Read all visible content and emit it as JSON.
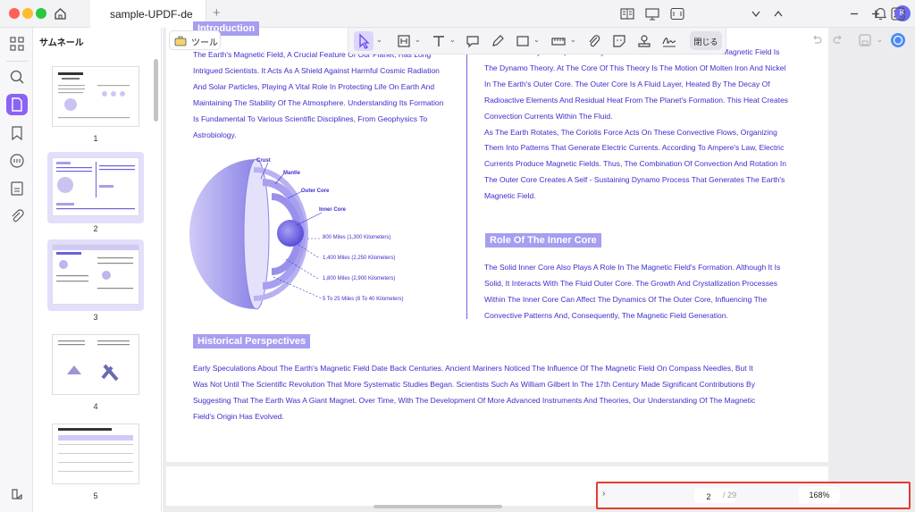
{
  "window": {
    "tab_title": "sample-UPDF-de",
    "add_tab": "+",
    "avatar_letter": "K"
  },
  "sidebar": {
    "title": "サムネール",
    "pages": [
      "1",
      "2",
      "3",
      "4",
      "5"
    ],
    "selected_pages": [
      "2",
      "3"
    ]
  },
  "toolbar": {
    "tools_label": "ツール",
    "close_label": "閉じる",
    "accent_color": "#8a63f5"
  },
  "document": {
    "intro_heading": "Introduction",
    "intro_lines": [
      "The Earth's Magnetic Field, A Crucial Feature Of Our Planet, Has Long",
      "Intrigued Scientists. It Acts As A Shield Against Harmful Cosmic Radiation",
      "And Solar Particles, Playing A Vital Role In Protecting Life On Earth And",
      "Maintaining The Stability Of The Atmosphere. Understanding Its Formation",
      "Is Fundamental To Various Scientific Disciplines, From Geophysics To",
      "Astrobiology."
    ],
    "diagram_labels": [
      "Crust",
      "Mantle",
      "Outer Core",
      "Inner Core"
    ],
    "diagram_dims": [
      "800 Miles (1,300 Kilometers)",
      "1,400 Miles (2,250 Kilometers)",
      "1,800 Miles (2,900 Kilometers)",
      "5 To 25 Miles (8 To 40 Kilometers)"
    ],
    "right_lines": [
      "The Most Widely - Accepted Theory For The Formation Of The Earth's Magnetic Field Is",
      "The Dynamo Theory. At The Core Of This Theory Is The Motion Of Molten Iron And Nickel",
      "In The Earth's Outer Core. The Outer Core Is A Fluid Layer, Heated By The Decay Of",
      "Radioactive Elements And Residual Heat From The Planet's Formation. This Heat Creates",
      "Convection Currents Within The Fluid.",
      "As The Earth Rotates, The Coriolis Force Acts On These Convective Flows, Organizing",
      "Them Into Patterns That Generate Electric Currents. According To Ampere's Law, Electric",
      "Currents Produce Magnetic Fields. Thus, The Combination Of Convection And Rotation In",
      "The Outer Core Creates A Self - Sustaining Dynamo Process That Generates The Earth's",
      "Magnetic Field."
    ],
    "inner_heading": "Role Of The Inner Core",
    "inner_lines": [
      "The Solid Inner Core Also Plays A Role In The Magnetic Field's Formation. Although It Is",
      "Solid, It Interacts With The Fluid Outer Core. The Growth And Crystallization Processes",
      "Within The Inner Core Can Affect The Dynamics Of The Outer Core, Influencing The",
      "Convective Patterns And, Consequently, The Magnetic Field Generation."
    ],
    "history_heading": "Historical Perspectives",
    "history_lines": [
      "Early Speculations About The Earth's Magnetic Field Date Back Centuries. Ancient Mariners Noticed The Influence Of The Magnetic Field On Compass Needles, But It",
      "Was Not Until The Scientific Revolution That More Systematic Studies Began. Scientists Such As William Gilbert In The 17th Century Made Significant Contributions By",
      "Suggesting That The Earth Was A Giant Magnet. Over Time, With The Development Of More Advanced Instruments And Theories, Our Understanding Of The Magnetic",
      "Field's Origin Has Evolved."
    ]
  },
  "bottom_bar": {
    "current_page": "2",
    "total_pages": "/ 29",
    "zoom": "168%",
    "highlight_color": "#e23b30"
  }
}
